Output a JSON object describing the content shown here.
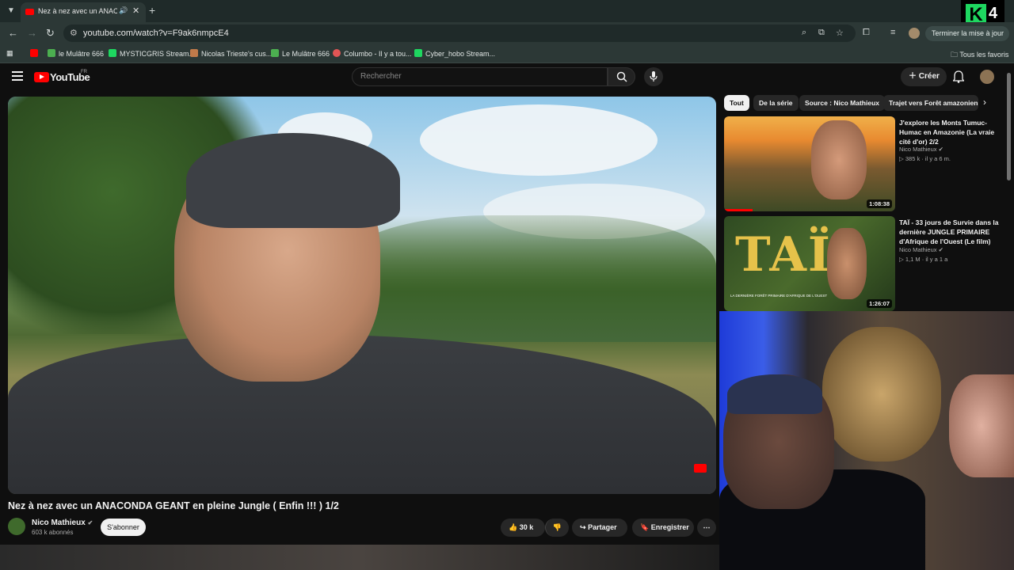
{
  "browser": {
    "tab_title": "Nez à nez avec un ANACONDA",
    "url": "youtube.com/watch?v=F9ak6nmpcE4",
    "update_label": "Terminer la mise à jour",
    "bookmarks": [
      {
        "label": "le Mulâtre 666",
        "color": "#4caf50"
      },
      {
        "label": "MYSTICGRIS Stream...",
        "color": "#1ed760"
      },
      {
        "label": "Nicolas Trieste's cus...",
        "color": "#c07a4a"
      },
      {
        "label": "Le Mulâtre 666",
        "color": "#4caf50"
      },
      {
        "label": "Columbo - Il y a tou...",
        "color": "#e25555"
      },
      {
        "label": "Cyber_hobo Stream...",
        "color": "#1ed760"
      }
    ],
    "all_favorites": "Tous les favoris"
  },
  "overlay_badge": {
    "letter": "K",
    "number": "4"
  },
  "youtube": {
    "logo_text": "YouTube",
    "region": "FR",
    "search_placeholder": "Rechercher",
    "create_label": "Créer"
  },
  "video": {
    "title": "Nez à nez avec un ANACONDA GEANT en pleine Jungle ( Enfin !!! ) 1/2",
    "channel": "Nico Mathieux",
    "subscribers": "603 k abonnés",
    "subscribe_label": "S'abonner",
    "likes": "30 k",
    "share_label": "Partager",
    "save_label": "Enregistrer"
  },
  "chips": [
    "Tout",
    "De la série",
    "Source : Nico Mathieux",
    "Trajet vers Forêt amazonienne"
  ],
  "recommendations": [
    {
      "title": "J'explore les Monts Tumuc-Humac en Amazonie (La vraie cité d'or) 2/2",
      "channel": "Nico Mathieux",
      "views": "385 k",
      "age": "il y a 6 m.",
      "duration": "1:08:38"
    },
    {
      "title": "TAÏ - 33 jours de Survie dans la dernière JUNGLE PRIMAIRE d'Afrique de l'Ouest (Le film)",
      "channel": "Nico Mathieux",
      "views": "1,1 M",
      "age": "il y a 1 a",
      "duration": "1:26:07",
      "thumb_text": "TAÏ",
      "thumb_subtext": "LA DERNIÈRE FORÊT PRIMAIRE D'AFRIQUE DE L'OUEST"
    }
  ],
  "colors": {
    "accent": "#ff0000",
    "bg": "#0f0f0f",
    "chrome": "#2c3836"
  }
}
